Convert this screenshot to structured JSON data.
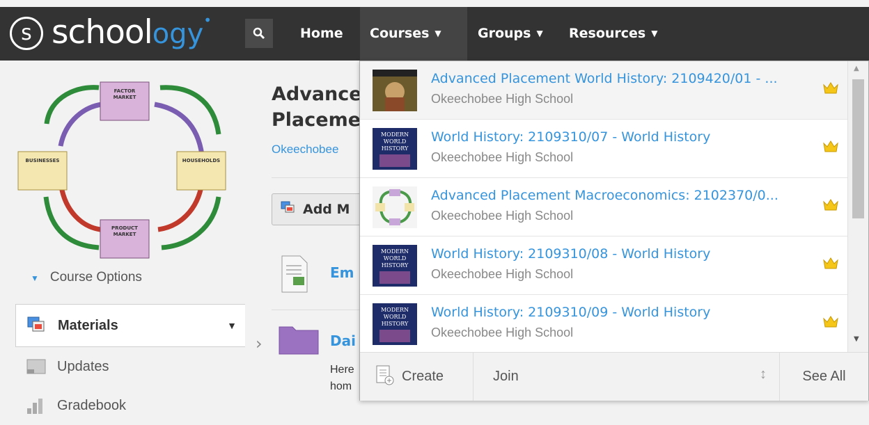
{
  "app": {
    "logo": {
      "text_main": "schoo",
      "text_accent": "ogy",
      "text_l": "l",
      "circle_letter": "s"
    },
    "nav": {
      "search_icon": "search-icon",
      "home": "Home",
      "courses": "Courses",
      "groups": "Groups",
      "resources": "Resources"
    },
    "accent_color": "#3694dc",
    "topbar_color": "#333333"
  },
  "sidebar": {
    "course_options": "Course Options",
    "items": [
      {
        "label": "Materials",
        "icon": "materials-icon",
        "active": true
      },
      {
        "label": "Updates",
        "icon": "updates-icon"
      },
      {
        "label": "Gradebook",
        "icon": "gradebook-icon"
      }
    ]
  },
  "main": {
    "title_line1": "Advance",
    "title_line2": "Placeme",
    "school": "Okeechobee",
    "add_button": "Add M",
    "items": [
      {
        "title": "Em",
        "icon": "document-icon"
      },
      {
        "title": "Dai",
        "icon": "folder-icon"
      }
    ],
    "desc_line1": "Here",
    "desc_line2": "hom"
  },
  "courses_dropdown": {
    "items": [
      {
        "name": "Advanced Placement World History: 2109420/01 - ...",
        "school": "Okeechobee High School",
        "thumb": "ap-world-history-thumb",
        "admin": true
      },
      {
        "name": "World History: 2109310/07 - World History",
        "school": "Okeechobee High School",
        "thumb": "modern-world-history-thumb",
        "admin": true
      },
      {
        "name": "Advanced Placement Macroeconomics: 2102370/0...",
        "school": "Okeechobee High School",
        "thumb": "macroeconomics-thumb",
        "admin": true
      },
      {
        "name": "World History: 2109310/08 - World History",
        "school": "Okeechobee High School",
        "thumb": "modern-world-history-thumb",
        "admin": true
      },
      {
        "name": "World History: 2109310/09 - World History",
        "school": "Okeechobee High School",
        "thumb": "modern-world-history-thumb",
        "admin": true
      }
    ],
    "footer": {
      "create": "Create",
      "join": "Join",
      "see_all": "See All"
    }
  },
  "diagram": {
    "factor_market": "FACTOR MARKET",
    "product_market": "PRODUCT MARKET",
    "businesses": "BUSINESSES",
    "households": "HOUSEHOLDS"
  }
}
